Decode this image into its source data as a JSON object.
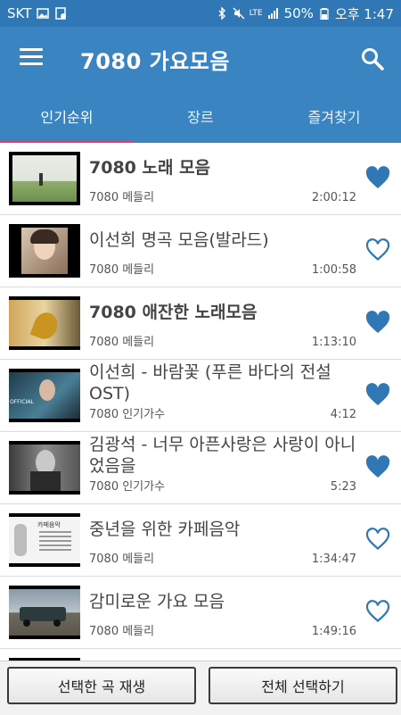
{
  "status": {
    "carrier": "SKT",
    "net": "LTE",
    "battery": "50%",
    "time": "오후 1:47"
  },
  "app": {
    "title": "7080 가요모음"
  },
  "tabs": [
    {
      "label": "인기순위"
    },
    {
      "label": "장르"
    },
    {
      "label": "즐겨찾기"
    }
  ],
  "songs": [
    {
      "title": "7080 노래 모음",
      "category": "7080 메들리",
      "duration": "2:00:12",
      "favorite": true
    },
    {
      "title": "이선희 명곡 모음(발라드)",
      "category": "7080 메들리",
      "duration": "1:00:58",
      "favorite": false
    },
    {
      "title": "7080 애잔한 노래모음",
      "category": "7080 메들리",
      "duration": "1:13:10",
      "favorite": true
    },
    {
      "title": "이선희 - 바람꽃 (푸른 바다의 전설 OST)",
      "category": "7080 인기가수",
      "duration": "4:12",
      "favorite": true,
      "thumb_text": "OFFICIAL"
    },
    {
      "title": "김광석 - 너무 아픈사랑은 사랑이 아니었음을",
      "category": "7080 인기가수",
      "duration": "5:23",
      "favorite": true
    },
    {
      "title": "중년을 위한 카페음악",
      "category": "7080 메들리",
      "duration": "1:34:47",
      "favorite": false,
      "thumb_text": "카페음악"
    },
    {
      "title": "감미로운 가요 모음",
      "category": "7080 메들리",
      "duration": "1:49:16",
      "favorite": false
    }
  ],
  "buttons": {
    "play_selected": "선택한 곡 재생",
    "select_all": "전체 선택하기"
  },
  "colors": {
    "primary": "#3a84c2",
    "status_bar": "#2f78b5",
    "tab_indicator": "#e23a72",
    "heart": "#2f78b5"
  }
}
